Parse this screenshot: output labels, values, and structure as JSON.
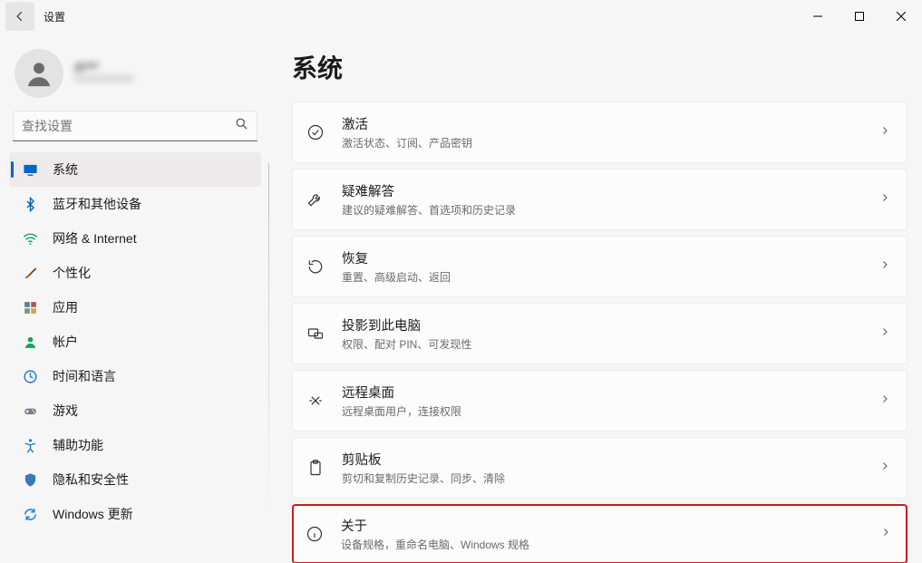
{
  "window": {
    "title": "设置"
  },
  "profile": {
    "name": "A***",
    "sub": "**************"
  },
  "search": {
    "placeholder": "查找设置"
  },
  "sidebar": {
    "items": [
      {
        "label": "系统"
      },
      {
        "label": "蓝牙和其他设备"
      },
      {
        "label": "网络 & Internet"
      },
      {
        "label": "个性化"
      },
      {
        "label": "应用"
      },
      {
        "label": "帐户"
      },
      {
        "label": "时间和语言"
      },
      {
        "label": "游戏"
      },
      {
        "label": "辅助功能"
      },
      {
        "label": "隐私和安全性"
      },
      {
        "label": "Windows 更新"
      }
    ]
  },
  "main": {
    "title": "系统",
    "cards": [
      {
        "title": "激活",
        "sub": "激活状态、订阅、产品密钥"
      },
      {
        "title": "疑难解答",
        "sub": "建议的疑难解答、首选项和历史记录"
      },
      {
        "title": "恢复",
        "sub": "重置、高级启动、返回"
      },
      {
        "title": "投影到此电脑",
        "sub": "权限、配对 PIN、可发现性"
      },
      {
        "title": "远程桌面",
        "sub": "远程桌面用户，连接权限"
      },
      {
        "title": "剪贴板",
        "sub": "剪切和复制历史记录、同步、清除"
      },
      {
        "title": "关于",
        "sub": "设备规格，重命名电脑、Windows 规格"
      }
    ]
  }
}
